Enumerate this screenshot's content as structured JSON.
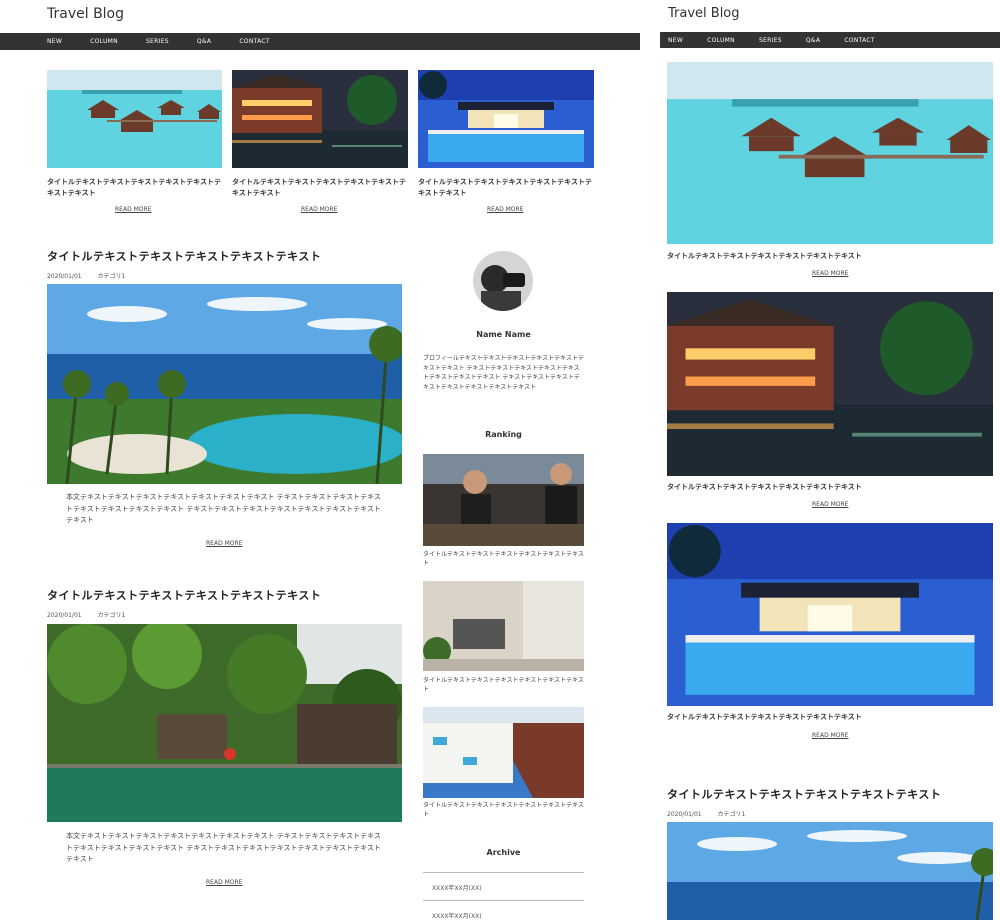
{
  "site": {
    "title": "Travel Blog"
  },
  "nav": [
    "NEW",
    "COLUMN",
    "SERIES",
    "Q&A",
    "CONTACT"
  ],
  "card_title": "タイトルテキストテキストテキストテキストテキストテキストテキスト",
  "card_title_mobile": "タイトルテキストテキストテキストテキストテキストテキスト",
  "read_more": "READ MORE",
  "post": {
    "title": "タイトルテキストテキストテキストテキストテキスト",
    "date": "2020/01/01",
    "category": "カテゴリ1",
    "excerpt": "本文テキストテキストテキストテキストテキストテキストテキスト テキストテキストテキストテキストテキストテキストテキストテキスト テキストテキストテキストテキストテキストテキストテキストテキスト"
  },
  "sidebar": {
    "profile_name": "Name Name",
    "profile_text": "プロフィールテキストテキストテキストテキストテキストテキストテキスト テキストテキストテキストテキストテキストテキストテキストテキスト テキストテキストテキストテキストテキストテキストテキストテキスト",
    "ranking_heading": "Ranking",
    "ranking_caption": "タイトルテキストテキストテキストテキストテキストテキスト",
    "archive_heading": "Archive",
    "archive_items": [
      "XXXX年XX月(XX)",
      "XXXX年XX月(XX)"
    ]
  },
  "colors": {
    "nav_bg": "#333333",
    "sea": "#3ec6d6",
    "night": "#1e2430",
    "sky": "#2b5fd1"
  }
}
